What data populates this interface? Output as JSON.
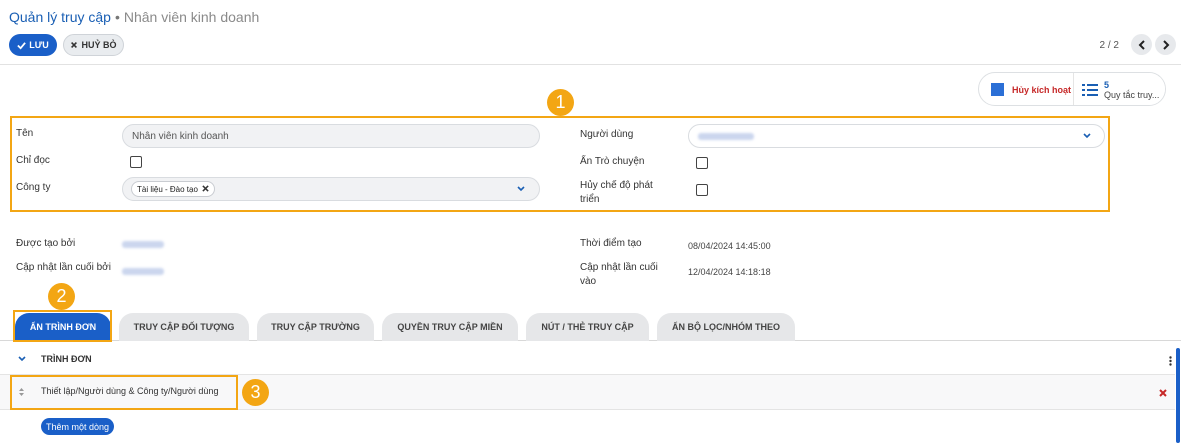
{
  "breadcrumb": {
    "parent": "Quản lý truy cập",
    "separator": "•",
    "current": "Nhân viên kinh doanh"
  },
  "toolbar": {
    "save_label": "LƯU",
    "cancel_label": "HUỶ BỎ"
  },
  "pager": {
    "text": "2 / 2"
  },
  "smart_buttons": {
    "inactive_label": "Hủy kích hoạt",
    "rules_count": "5",
    "rules_label": "Quy tắc truy..."
  },
  "annotations": {
    "one": "1",
    "two": "2",
    "three": "3"
  },
  "form": {
    "name_label": "Tên",
    "name_value": "Nhân viên kinh doanh",
    "readonly_label": "Chỉ đọc",
    "company_label": "Công ty",
    "company_tag": "Tài liệu - Đào tạo",
    "users_label": "Người dùng",
    "hide_chat_label": "Ẩn Trò chuyện",
    "disable_dev_label": "Hủy chế độ phát triển"
  },
  "meta": {
    "created_by_label": "Được tạo bởi",
    "updated_by_label": "Cập nhật lần cuối bởi",
    "created_at_label": "Thời điểm tạo",
    "created_at_value": "08/04/2024 14:45:00",
    "updated_at_label": "Cập nhật lần cuối vào",
    "updated_at_value": "12/04/2024 14:18:18"
  },
  "tabs": [
    {
      "label": "ẨN TRÌNH ĐƠN",
      "active": true
    },
    {
      "label": "TRUY CẬP ĐỐI TƯỢNG",
      "active": false
    },
    {
      "label": "TRUY CẬP TRƯỜNG",
      "active": false
    },
    {
      "label": "QUYỀN TRUY CẬP MIỀN",
      "active": false
    },
    {
      "label": "NÚT / THẺ TRUY CẬP",
      "active": false
    },
    {
      "label": "ẨN BỘ LỌC/NHÓM THEO",
      "active": false
    }
  ],
  "menu_table": {
    "column_header": "TRÌNH ĐƠN",
    "rows": [
      {
        "path": "Thiết lập/Người dùng & Công ty/Người dùng"
      }
    ],
    "add_line_label": "Thêm một dòng"
  },
  "colors": {
    "primary": "#1a5fc8",
    "annotation": "#f3a614",
    "danger": "#c62828"
  }
}
